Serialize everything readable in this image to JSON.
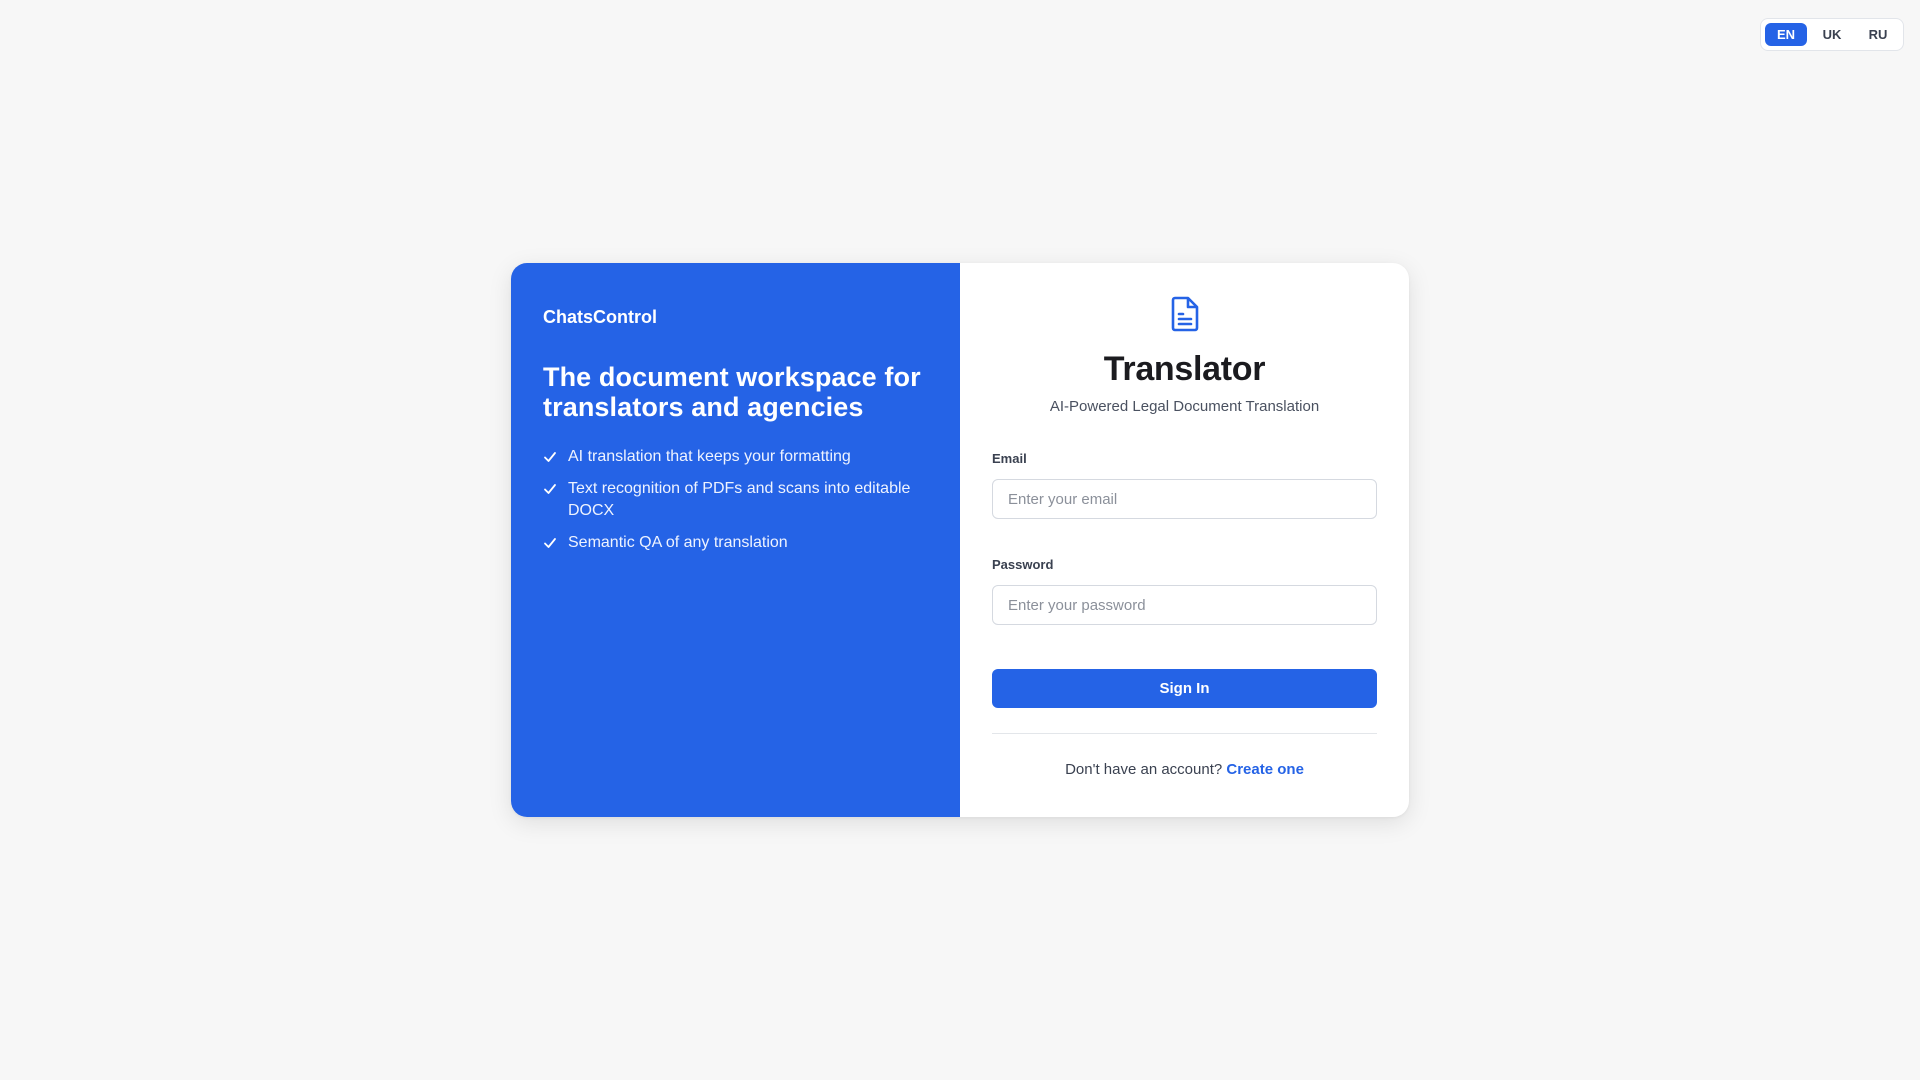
{
  "language_switcher": {
    "options": [
      "EN",
      "UK",
      "RU"
    ],
    "selected": "EN",
    "accent_color": "#2563e6"
  },
  "promo": {
    "brand": "ChatsControl",
    "headline": "The document workspace for translators and agencies",
    "features": [
      "AI translation that keeps your formatting",
      "Text recognition of PDFs and scans into editable DOCX",
      "Semantic QA of any translation"
    ],
    "feature_icon": "check-icon",
    "background_color": "#2563e6"
  },
  "login": {
    "icon": "document-icon",
    "title": "Translator",
    "subtitle": "AI-Powered Legal Document Translation",
    "email": {
      "label": "Email",
      "placeholder": "Enter your email",
      "value": ""
    },
    "password": {
      "label": "Password",
      "placeholder": "Enter your password",
      "value": ""
    },
    "submit_label": "Sign In",
    "signup_prompt": "Don't have an account?",
    "signup_link": "Create one"
  }
}
